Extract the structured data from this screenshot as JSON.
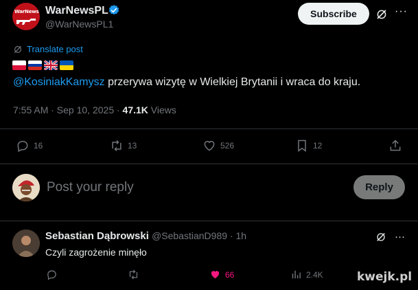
{
  "post": {
    "author_name": "WarNewsPL",
    "author_handle": "@WarNewsPL1",
    "avatar_text": "WarNewsPL",
    "subscribe_label": "Subscribe",
    "more_label": "···",
    "translate_label": "Translate post",
    "flags": [
      "poland",
      "russia",
      "uk",
      "ukraine"
    ],
    "mention": "@KosiniakKamysz",
    "text": " przerywa wizytę w Wielkiej Brytanii i wraca do kraju.",
    "timestamp": "7:55 AM · Sep 10, 2025 · ",
    "views_count": "47.1K",
    "views_label": " Views"
  },
  "actions": {
    "replies": "16",
    "reposts": "13",
    "likes": "526",
    "bookmarks": "12"
  },
  "composer": {
    "placeholder": "Post your reply",
    "reply_label": "Reply"
  },
  "comment": {
    "author_name": "Sebastian Dąbrowski",
    "author_handle": "@SebastianD989 · 1h",
    "text": "Czyli zagrożenie minęło",
    "likes": "66",
    "views": "2.4K",
    "more_label": "···"
  },
  "watermark": "kwejk.pl",
  "colors": {
    "accent": "#1d9bf0",
    "like_pink": "#f91880",
    "muted": "#71767b",
    "avatar_red": "#c0111a"
  }
}
